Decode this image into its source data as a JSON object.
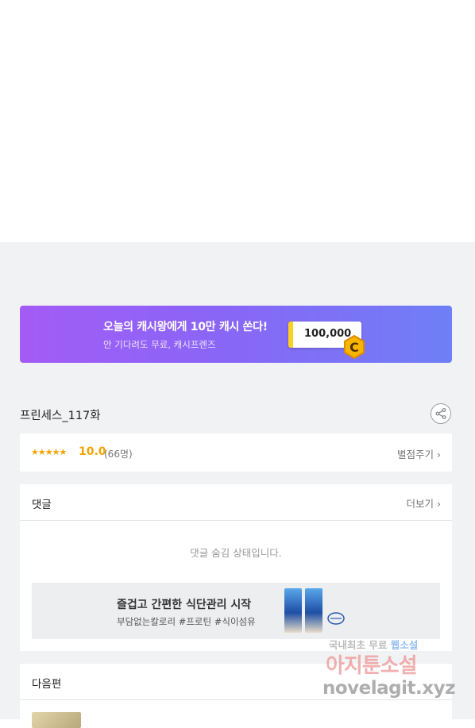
{
  "promo": {
    "title": "오늘의 캐시왕에게 10만 캐시 쏜다!",
    "subtitle": "안 기다려도 무료, 캐시프렌즈",
    "amount": "100,000",
    "coin_letter": "C"
  },
  "episode": {
    "title": "프린세스_117화",
    "share_icon": "share-icon"
  },
  "rating": {
    "stars": "★★★★★",
    "score": "10.0",
    "count": "(66명)",
    "rate_label": "별점주기",
    "chevron": "›"
  },
  "comments": {
    "title": "댓글",
    "more_label": "더보기",
    "chevron": "›",
    "hidden_message": "댓글 숨김 상태입니다."
  },
  "ad": {
    "title": "즐겁고 간편한 식단관리 시작",
    "subtitle": "부담없는칼로리 #프로틴 #식이섬유"
  },
  "next": {
    "title": "다음편"
  },
  "watermark": {
    "line1_a": "국내최초 무료",
    "line1_b": "웹소설",
    "line2": "아지툰소설",
    "line3": "novelagit.xyz"
  },
  "colors": {
    "accent_star": "#f5a300",
    "promo_start": "#a35cf5",
    "promo_end": "#6f7ff6",
    "background_gray": "#f1f2f4"
  }
}
